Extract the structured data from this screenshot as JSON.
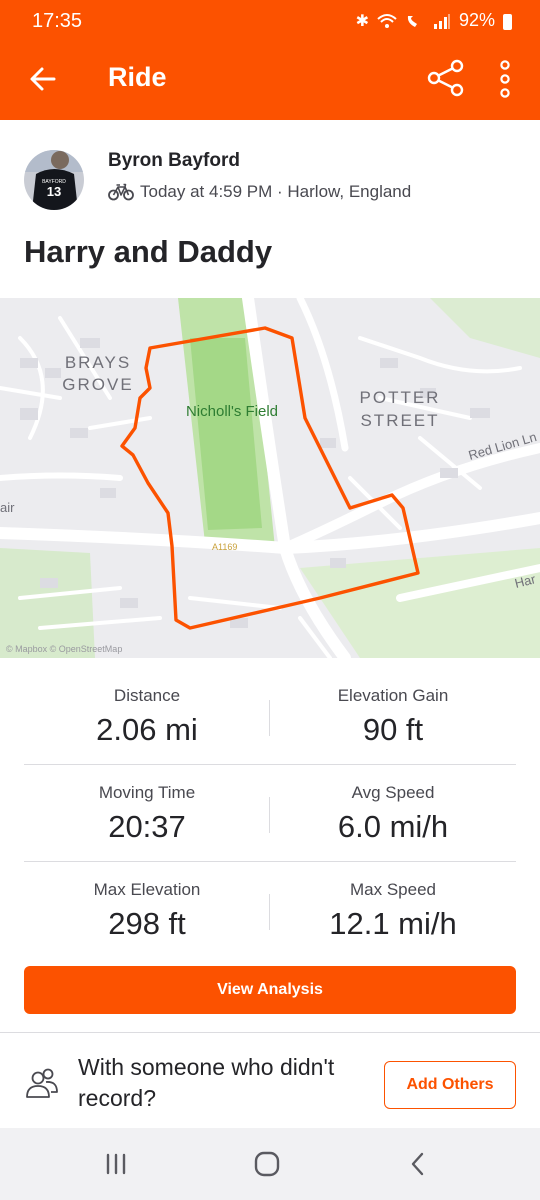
{
  "status_bar": {
    "time": "17:35",
    "battery": "92%",
    "icons": [
      "bluetooth-icon",
      "wifi-icon",
      "wifi-calling-icon",
      "signal-icon",
      "battery-icon"
    ]
  },
  "app_bar": {
    "title": "Ride",
    "back_icon": "arrow-left-icon",
    "share_icon": "share-icon",
    "more_icon": "more-vertical-icon",
    "background": "#fc5200"
  },
  "athlete": {
    "name": "Byron Bayford",
    "activity_icon": "bike-icon",
    "meta": "Today at 4:59 PM · Harlow, England",
    "avatar_jersey": {
      "top_text": "BAYFORD",
      "number": "13"
    }
  },
  "activity_title": "Harry and Daddy",
  "map": {
    "labels": {
      "brays_line1": "BRAYS",
      "brays_line2": "GROVE",
      "field": "Nicholl's Field",
      "potter_line1": "POTTER",
      "potter_line2": "STREET",
      "red_lion": "Red Lion Ln",
      "road": "A1169",
      "left_edge": "air",
      "right_edge": "Har"
    },
    "attribution": "© Mapbox © OpenStreetMap",
    "route_color": "#fc5200"
  },
  "stats": [
    {
      "left": {
        "label": "Distance",
        "value": "2.06 mi"
      },
      "right": {
        "label": "Elevation Gain",
        "value": "90 ft"
      }
    },
    {
      "left": {
        "label": "Moving Time",
        "value": "20:37"
      },
      "right": {
        "label": "Avg Speed",
        "value": "6.0 mi/h"
      }
    },
    {
      "left": {
        "label": "Max Elevation",
        "value": "298 ft"
      },
      "right": {
        "label": "Max Speed",
        "value": "12.1 mi/h"
      }
    }
  ],
  "actions": {
    "view_analysis": "View Analysis",
    "with_someone": "With someone who didn't record?",
    "add_others": "Add Others"
  },
  "nav": {
    "recents_icon": "recent-apps-icon",
    "home_icon": "home-icon",
    "back_icon": "back-chevron-icon"
  },
  "colors": {
    "accent": "#fc5200",
    "text": "#242428",
    "secondary": "#494950"
  }
}
